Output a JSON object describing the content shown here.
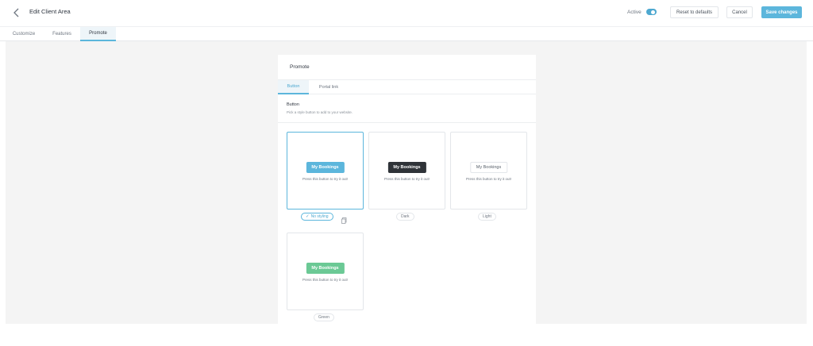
{
  "header": {
    "title": "Edit Client Area",
    "active_label": "Active",
    "active_on": true,
    "reset_label": "Reset to defaults",
    "cancel_label": "Cancel",
    "save_label": "Save changes"
  },
  "tabs": [
    {
      "label": "Customize"
    },
    {
      "label": "Features"
    },
    {
      "label": "Promote",
      "active": true
    }
  ],
  "panel": {
    "title": "Promote",
    "tabs": [
      {
        "label": "Button",
        "active": true
      },
      {
        "label": "Portal link"
      }
    ],
    "section_title": "Button",
    "section_desc": "Pick a style button to add to your website.",
    "styles": [
      {
        "button_label": "My Bookings",
        "hint": "Press this button to try it out!",
        "name": "No styling",
        "selected": true
      },
      {
        "button_label": "My Bookings",
        "hint": "Press this button to try it out!",
        "name": "Dark"
      },
      {
        "button_label": "My Bookings",
        "hint": "Press this button to try it out!",
        "name": "Light"
      },
      {
        "button_label": "My Bookings",
        "hint": "Press this button to try it out!",
        "name": "Green"
      }
    ]
  },
  "colors": {
    "accent": "#5cb6dc",
    "dark": "#2f3338",
    "green": "#6bc995"
  }
}
